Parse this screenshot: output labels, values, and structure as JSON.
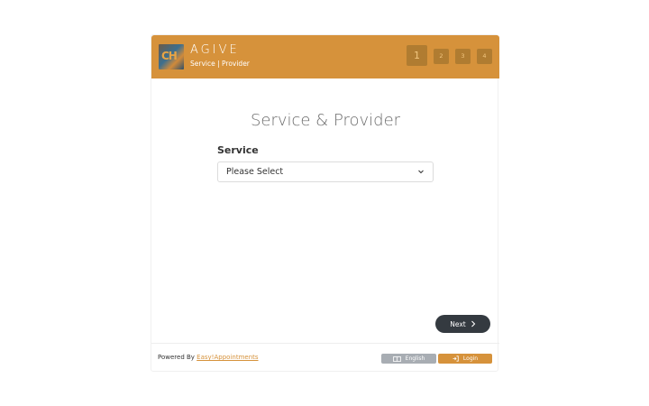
{
  "header": {
    "logo_text": "CH",
    "company_name": "AGIVE",
    "subtitle": "Service | Provider",
    "steps": [
      "1",
      "2",
      "3",
      "4"
    ],
    "active_step": "1"
  },
  "main": {
    "title": "Service & Provider",
    "service_label": "Service",
    "service_select_value": "Please Select",
    "next_label": "Next"
  },
  "footer": {
    "powered_prefix": "Powered By",
    "powered_link": "Easy!Appointments",
    "language_label": "English",
    "login_label": "Login"
  },
  "colors": {
    "brand": "#d6923b",
    "dark_button": "#343a40",
    "language_button": "#a8adb3"
  },
  "icons": {
    "select": "chevron-down-icon",
    "next": "chevron-right-icon",
    "language": "language-icon",
    "login": "login-icon"
  }
}
